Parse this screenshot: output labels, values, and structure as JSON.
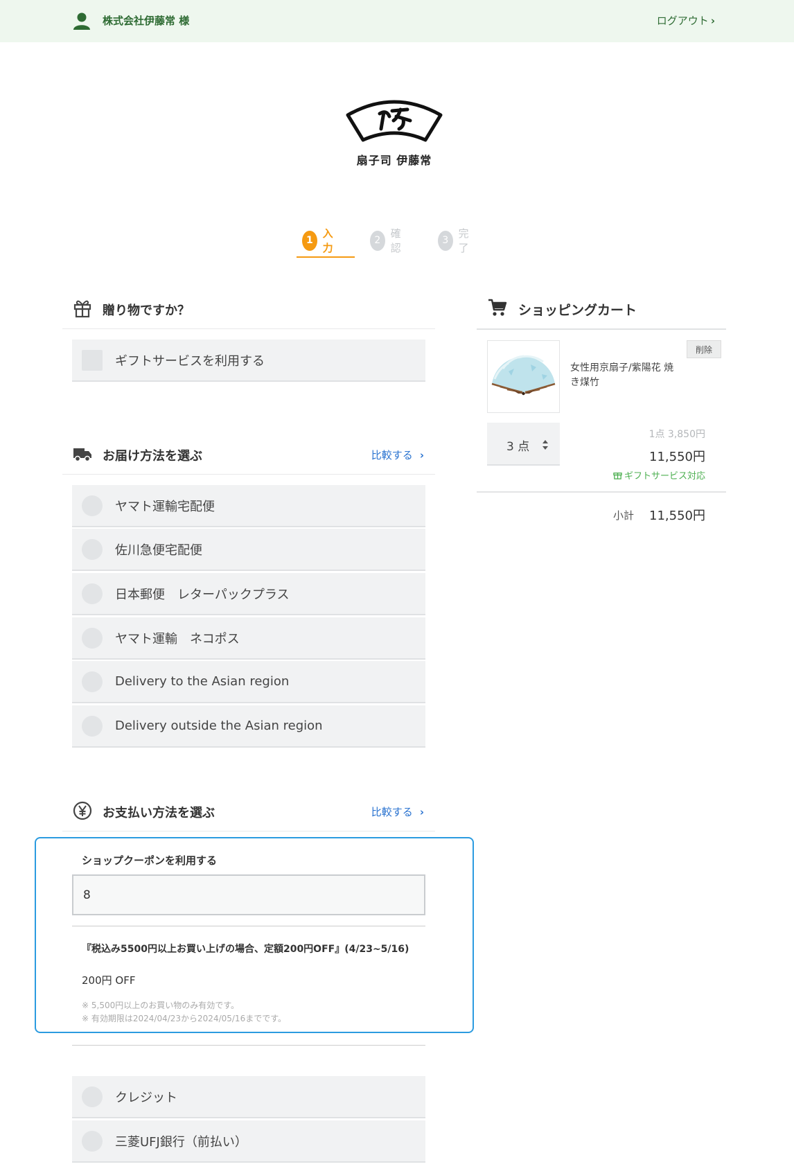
{
  "header": {
    "company": "株式会社伊藤常 様",
    "logout": "ログアウト",
    "logout_chevron": "›"
  },
  "logo": {
    "name": "扇子司 伊藤常"
  },
  "steps": [
    {
      "num": "1",
      "label": "入力"
    },
    {
      "num": "2",
      "label": "確認"
    },
    {
      "num": "3",
      "label": "完了"
    }
  ],
  "gift": {
    "title": "贈り物ですか？",
    "option": "ギフトサービスを利用する"
  },
  "delivery": {
    "title": "お届け方法を選ぶ",
    "compare": "比較する",
    "options": [
      "ヤマト運輸宅配便",
      "佐川急便宅配便",
      "日本郵便　レターパックプラス",
      "ヤマト運輸　ネコポス",
      "Delivery to the Asian region",
      "Delivery outside the Asian region"
    ]
  },
  "payment": {
    "title": "お支払い方法を選ぶ",
    "compare": "比較する",
    "coupon": {
      "title": "ショップクーポンを利用する",
      "input_value": "8",
      "name": "『税込み5500円以上お買い上げの場合、定額200円OFF』(4/23~5/16)",
      "discount": "200円 OFF",
      "note1": "※ 5,500円以上のお買い物のみ有効です。",
      "note2": "※ 有効期限は2024/04/23から2024/05/16までです。"
    },
    "options": [
      "クレジット",
      "三菱UFJ銀行（前払い）"
    ]
  },
  "cart": {
    "title": "ショッピングカート",
    "delete": "削除",
    "item_name": "女性用京扇子/紫陽花 焼き煤竹",
    "quantity": "3 点",
    "unit_price": "1点 3,850円",
    "line_total": "11,550円",
    "gift_label": "ギフトサービス対応",
    "subtotal_label": "小計",
    "subtotal_value": "11,550円"
  },
  "colors": {
    "accent_orange": "#f59a12",
    "link_blue": "#2a73d0",
    "header_green": "#2e6b33",
    "coupon_border": "#2b9be0"
  }
}
